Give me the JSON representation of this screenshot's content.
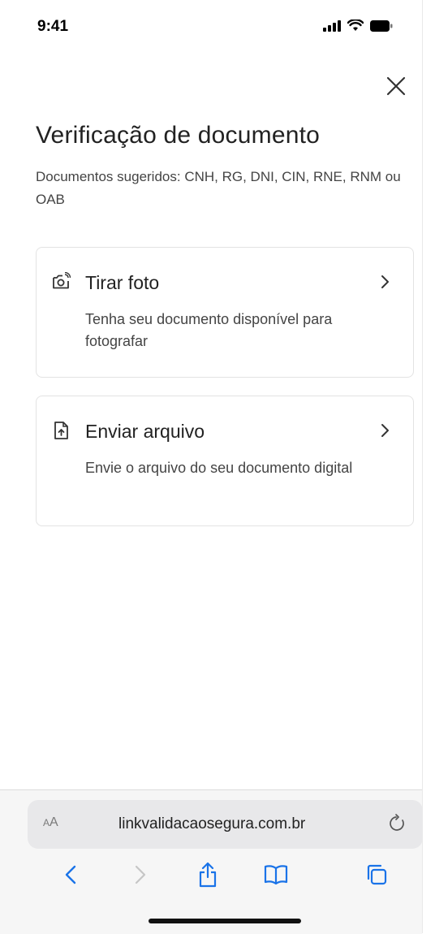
{
  "status_bar": {
    "time": "9:41",
    "icons": [
      "signal-icon",
      "wifi-icon",
      "battery-icon"
    ]
  },
  "header": {
    "close_icon": "close-icon",
    "title": "Verificação de documento",
    "subtitle": "Documentos sugeridos: CNH, RG, DNI, CIN, RNE, RNM ou OAB"
  },
  "options": [
    {
      "icon": "camera-icon",
      "title": "Tirar foto",
      "description": "Tenha seu documento disponível para fotografar"
    },
    {
      "icon": "file-upload-icon",
      "title": "Enviar arquivo",
      "description": "Envie o arquivo do seu documento digital"
    }
  ],
  "browser": {
    "aa_small": "A",
    "aa_large": "A",
    "url": "linkvalidacaosegura.com.br",
    "toolbar_icons": [
      "back-icon",
      "forward-icon",
      "share-icon",
      "bookmarks-icon",
      "tabs-icon"
    ],
    "accent_color": "#1a73e8"
  },
  "colors": {
    "text": "#222222",
    "muted": "#444444",
    "border": "#e3e3e3"
  }
}
